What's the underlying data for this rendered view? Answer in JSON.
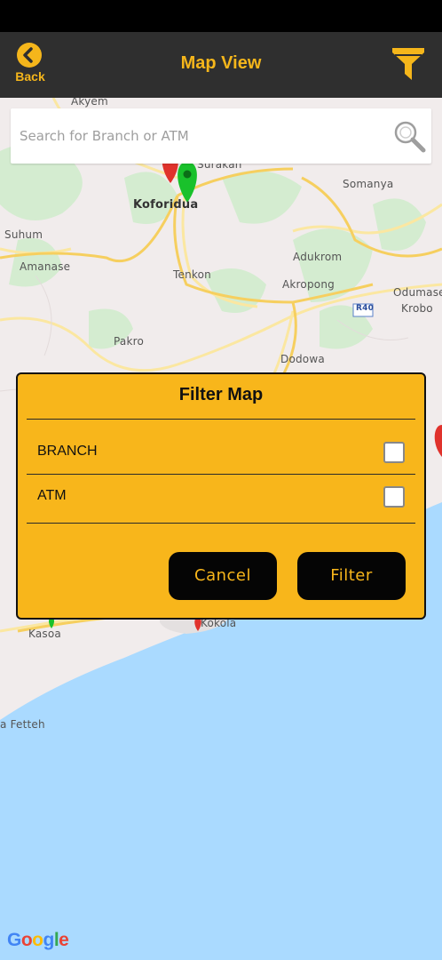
{
  "header": {
    "title": "Map View",
    "back_label": "Back"
  },
  "search": {
    "placeholder": "Search for Branch or ATM"
  },
  "map": {
    "places": [
      "Akyem",
      "Koforidua",
      "Surakan",
      "Somanya",
      "Suhum",
      "Amanase",
      "Tenkon",
      "Adukrom",
      "Akropong",
      "Odumase",
      "Krobo",
      "Pakro",
      "Dodowa",
      "Kasoa",
      "Kokola",
      "a Fetteh"
    ],
    "road_badge": "R40",
    "attribution": [
      "G",
      "o",
      "o",
      "g",
      "l",
      "e"
    ]
  },
  "dialog": {
    "title": "Filter Map",
    "options": [
      {
        "label": "BRANCH",
        "checked": false
      },
      {
        "label": "ATM",
        "checked": false
      }
    ],
    "cancel_label": "Cancel",
    "filter_label": "Filter"
  },
  "colors": {
    "accent": "#f8b61b",
    "header_bg": "#2f2f2f",
    "sea": "#aadaff",
    "marker_green": "#19c12b",
    "marker_red": "#e0322c"
  }
}
